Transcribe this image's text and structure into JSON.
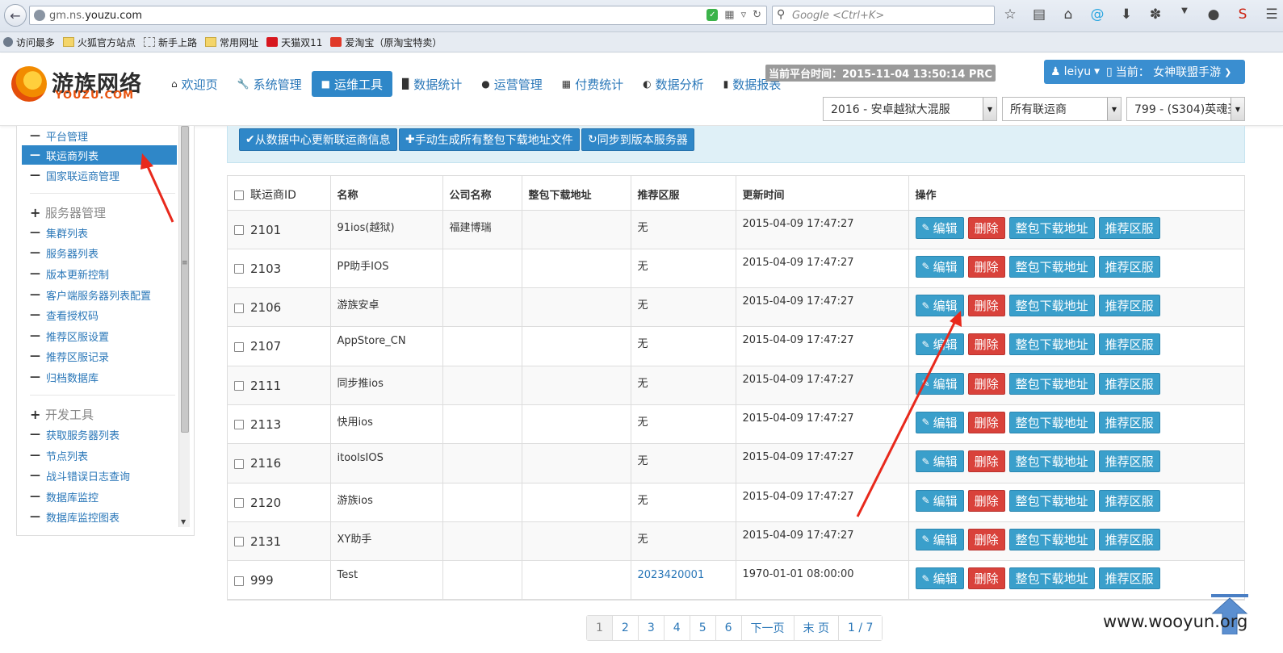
{
  "browser": {
    "url_prefix": "gm.ns.",
    "url_domain": "youzu.com",
    "search_placeholder": "Google <Ctrl+K>",
    "bookmarks": [
      {
        "label": "访问最多",
        "icon": "gear-icon"
      },
      {
        "label": "火狐官方站点",
        "icon": "folder-icon"
      },
      {
        "label": "新手上路",
        "icon": "dashed-square-icon"
      },
      {
        "label": "常用网址",
        "icon": "folder-icon"
      },
      {
        "label": "天猫双11",
        "icon": "tmall-icon"
      },
      {
        "label": "爱淘宝（原淘宝特卖）",
        "icon": "taobao-icon"
      }
    ]
  },
  "header": {
    "logo_cn": "游族网络",
    "logo_en": "YOUZU.COM",
    "server_time": "当前平台时间：2015-11-04 13:50:14 PRC",
    "user": "leiyu",
    "platform": "当前：  女神联盟手游",
    "nav": [
      {
        "label": "欢迎页",
        "icon": "home-icon"
      },
      {
        "label": "系统管理",
        "icon": "wrench-icon"
      },
      {
        "label": "运维工具",
        "icon": "tools-icon"
      },
      {
        "label": "数据统计",
        "icon": "signal-icon"
      },
      {
        "label": "运营管理",
        "icon": "globe-icon"
      },
      {
        "label": "付费统计",
        "icon": "grid-icon"
      },
      {
        "label": "数据分析",
        "icon": "contrast-icon"
      },
      {
        "label": "数据报表",
        "icon": "book-icon"
      }
    ],
    "selects": {
      "game": "2016 - 安卓越狱大混服",
      "channel": "所有联运商",
      "server": "799 - (S304)英魂圣殿"
    }
  },
  "sidebar": {
    "items_top": [
      "平台管理",
      "联运商列表",
      "国家联运商管理"
    ],
    "group_server": "服务器管理",
    "items_server": [
      "集群列表",
      "服务器列表",
      "版本更新控制",
      "客户端服务器列表配置",
      "查看授权码",
      "推荐区服设置",
      "推荐区服记录",
      "归档数据库"
    ],
    "group_dev": "开发工具",
    "items_dev": [
      "获取服务器列表",
      "节点列表",
      "战斗错误日志查询",
      "数据库监控",
      "数据库监控图表"
    ]
  },
  "actions": {
    "update": "从数据中心更新联运商信息",
    "generate": "手动生成所有整包下载地址文件",
    "sync": "同步到版本服务器"
  },
  "table": {
    "headers": [
      "联运商ID",
      "名称",
      "公司名称",
      "整包下载地址",
      "推荐区服",
      "更新时间",
      "操作"
    ],
    "ops": {
      "edit": "编辑",
      "delete": "删除",
      "download": "整包下载地址",
      "recommend": "推荐区服"
    },
    "rows": [
      {
        "id": "2101",
        "name": "91ios(越狱)",
        "company": "福建博瑞",
        "download": "",
        "recommend": "无",
        "time": "2015-04-09 17:47:27"
      },
      {
        "id": "2103",
        "name": "PP助手IOS",
        "company": "",
        "download": "",
        "recommend": "无",
        "time": "2015-04-09 17:47:27"
      },
      {
        "id": "2106",
        "name": "游族安卓",
        "company": "",
        "download": "",
        "recommend": "无",
        "time": "2015-04-09 17:47:27"
      },
      {
        "id": "2107",
        "name": "AppStore_CN",
        "company": "",
        "download": "",
        "recommend": "无",
        "time": "2015-04-09 17:47:27"
      },
      {
        "id": "2111",
        "name": "同步推ios",
        "company": "",
        "download": "",
        "recommend": "无",
        "time": "2015-04-09 17:47:27"
      },
      {
        "id": "2113",
        "name": "快用ios",
        "company": "",
        "download": "",
        "recommend": "无",
        "time": "2015-04-09 17:47:27"
      },
      {
        "id": "2116",
        "name": "itoolsIOS",
        "company": "",
        "download": "",
        "recommend": "无",
        "time": "2015-04-09 17:47:27"
      },
      {
        "id": "2120",
        "name": "游族ios",
        "company": "",
        "download": "",
        "recommend": "无",
        "time": "2015-04-09 17:47:27"
      },
      {
        "id": "2131",
        "name": "XY助手",
        "company": "",
        "download": "",
        "recommend": "无",
        "time": "2015-04-09 17:47:27"
      },
      {
        "id": "999",
        "name": "Test",
        "company": "",
        "download": "",
        "recommend": "2023420001",
        "time": "1970-01-01 08:00:00"
      }
    ]
  },
  "pagination": [
    "1",
    "2",
    "3",
    "4",
    "5",
    "6",
    "下一页",
    "末 页",
    "1 / 7"
  ],
  "watermark": "www.wooyun.org",
  "colors": {
    "primary": "#2f87c8",
    "danger": "#d9423b",
    "info": "#3a9fcb",
    "annotation": "#e8291c"
  }
}
